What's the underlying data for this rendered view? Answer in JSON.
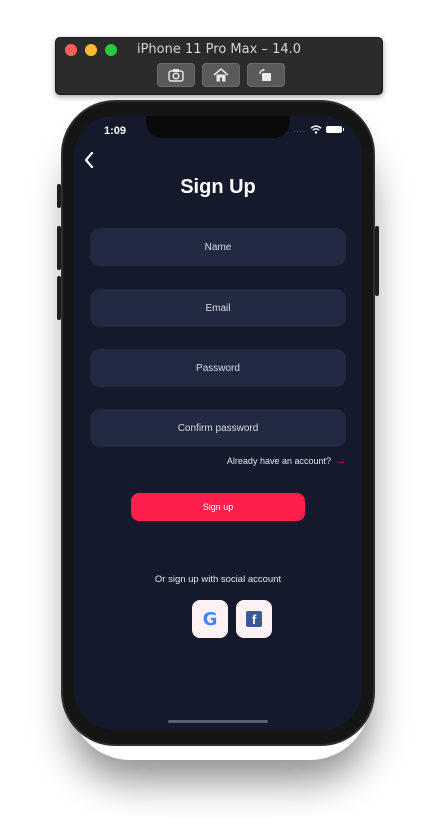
{
  "simulator": {
    "title": "iPhone 11 Pro Max – 14.0",
    "buttons": {
      "screenshot_icon": "camera-icon",
      "home_icon": "home-icon",
      "rotate_icon": "rotate-icon"
    }
  },
  "status_bar": {
    "time": "1:09",
    "signal": "....",
    "wifi_icon": "wifi-icon",
    "battery_icon": "battery-icon"
  },
  "screen": {
    "back_icon": "chevron-left-icon",
    "title": "Sign Up",
    "fields": {
      "name_placeholder": "Name",
      "email_placeholder": "Email",
      "password_placeholder": "Password",
      "confirm_password_placeholder": "Confirm password"
    },
    "login_link": "Already have an account?",
    "login_arrow": "→",
    "signup_label": "Sign up",
    "social_caption": "Or sign up with social account",
    "social": {
      "google_icon": "google-icon",
      "google_letter": "G",
      "facebook_icon": "facebook-icon",
      "facebook_letter": "f"
    }
  },
  "colors": {
    "background": "#141a2c",
    "field": "#222a42",
    "accent": "#ff1f4d",
    "social_button": "#fff2f4"
  }
}
